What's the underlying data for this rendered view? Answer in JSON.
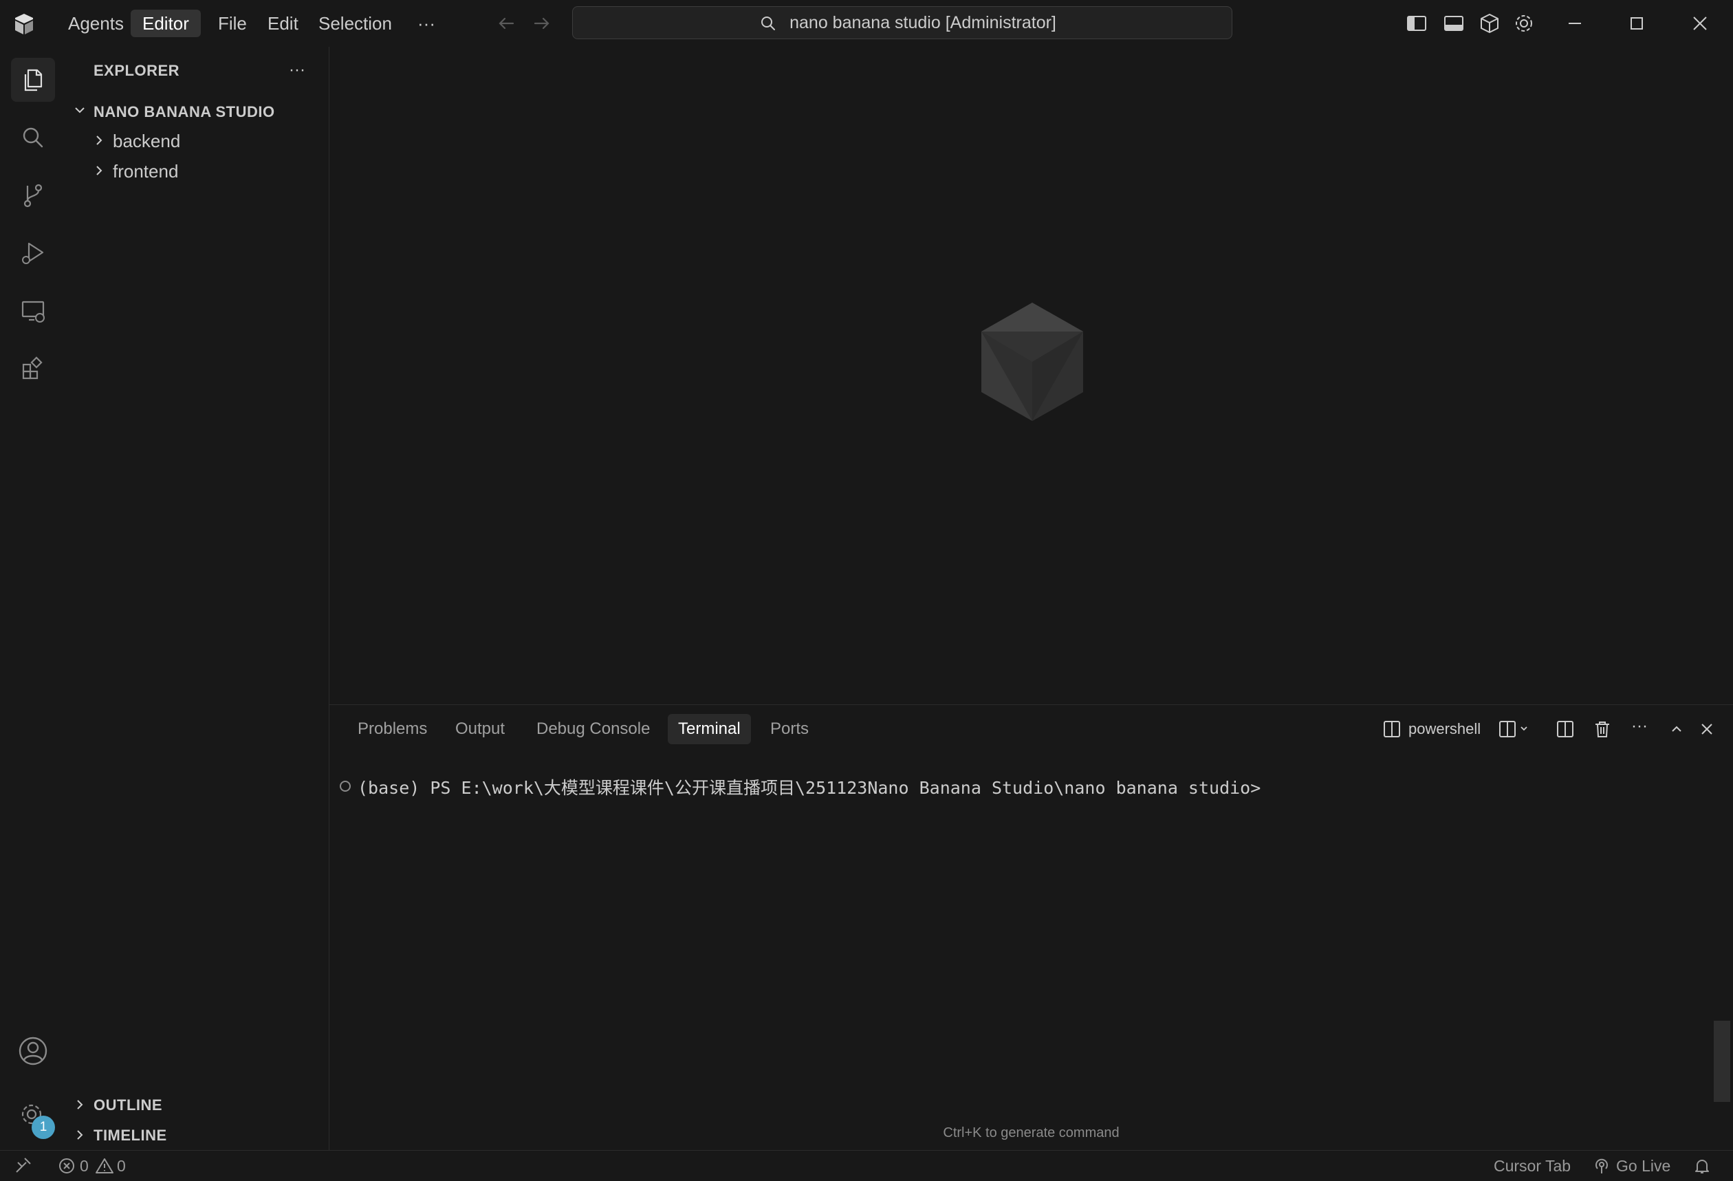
{
  "titlebar": {
    "menu": {
      "agents": "Agents",
      "editor": "Editor",
      "file": "File",
      "edit": "Edit",
      "selection": "Selection",
      "more": "···"
    },
    "search": "nano banana studio [Administrator]"
  },
  "explorer": {
    "title": "EXPLORER",
    "more": "···",
    "workspace": "NANO BANANA STUDIO",
    "items": [
      {
        "label": "backend",
        "type": "folder"
      },
      {
        "label": "frontend",
        "type": "folder"
      }
    ],
    "outline": "OUTLINE",
    "timeline": "TIMELINE"
  },
  "activity": {
    "settings_badge": "1"
  },
  "panel": {
    "tabs": [
      "Problems",
      "Output",
      "Debug Console",
      "Terminal",
      "Ports"
    ],
    "active_tab": "Terminal",
    "shell": "powershell",
    "more": "···",
    "terminal_line": "(base) PS E:\\work\\大模型课程课件\\公开课直播项目\\251123Nano Banana Studio\\nano banana studio>",
    "hint": "Ctrl+K to generate command"
  },
  "status": {
    "errors": "0",
    "warnings": "0",
    "cursor_tab": "Cursor Tab",
    "go_live": "Go Live"
  }
}
